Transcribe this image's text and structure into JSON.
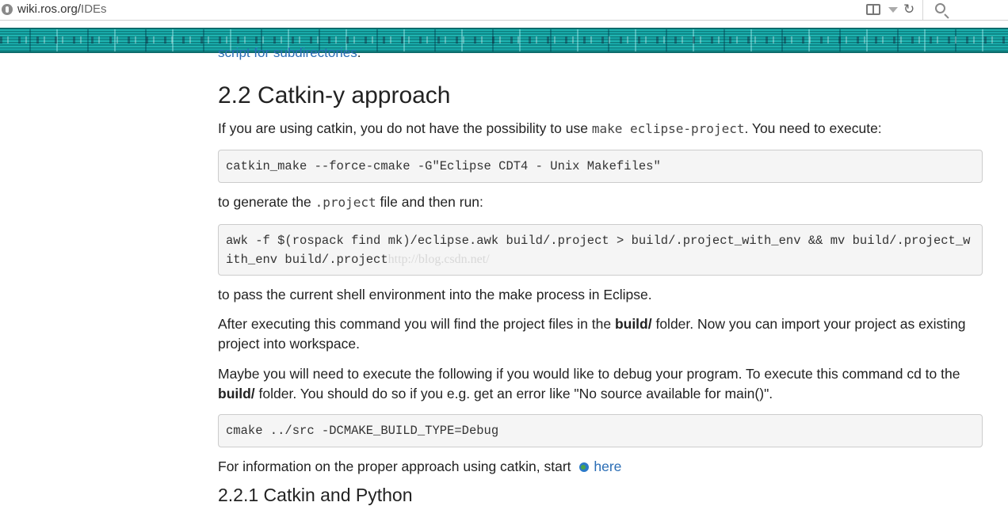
{
  "browser": {
    "url_host": "wiki.ros.org/",
    "url_path": "IDEs"
  },
  "page": {
    "top_cut_link": "script for subdirectories",
    "top_cut_suffix": ".",
    "section_title": "2.2 Catkin-y approach",
    "p1_before": "If you are using catkin, you do not have the possibility to use ",
    "p1_code": "make eclipse-project",
    "p1_after": ". You need to execute:",
    "code1": "catkin_make --force-cmake -G\"Eclipse CDT4 - Unix Makefiles\"",
    "p2_before": "to generate the ",
    "p2_code": ".project",
    "p2_after": " file and then run:",
    "code2": "awk -f $(rospack find mk)/eclipse.awk build/.project > build/.project_with_env && mv build/.project_with_env build/.project",
    "code2_watermark": "http://blog.csdn.net/",
    "p3": "to pass the current shell environment into the make process in Eclipse.",
    "p4_before": "After executing this command you will find the project files in the ",
    "p4_bold": "build/",
    "p4_after": " folder. Now you can import your project as existing project into workspace.",
    "p5_before": "Maybe you will need to execute the following if you would like to debug your program. To execute this command cd to the ",
    "p5_bold": "build/",
    "p5_after": " folder. You should do so if you e.g. get an error like \"No source available for main()\".",
    "code3": "cmake ../src -DCMAKE_BUILD_TYPE=Debug",
    "p6_before": "For information on the proper approach using catkin, start ",
    "p6_link": "here",
    "subsection_title": "2.2.1 Catkin and Python"
  },
  "icons": {
    "addr": "globe-icon",
    "reader": "reader-view-icon",
    "dropdown": "chevron-down-icon",
    "reload": "reload-icon",
    "search": "search-icon",
    "external": "external-link-icon"
  }
}
